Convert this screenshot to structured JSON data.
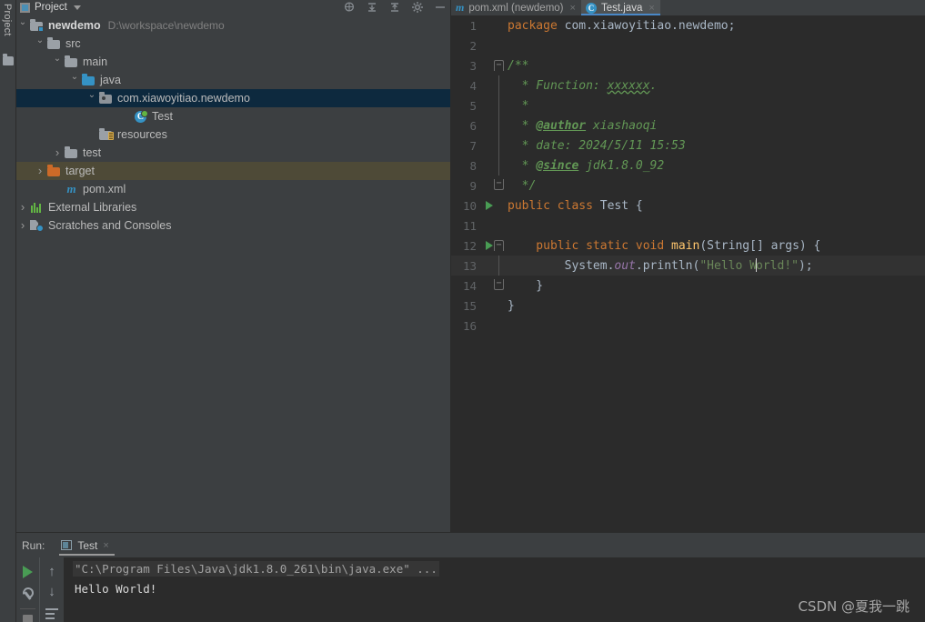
{
  "window": {
    "left_strip_label": "Project"
  },
  "project_panel": {
    "title": "Project",
    "icons": {
      "tab_icon": "project-panel-icon",
      "chevron": "chevron-down-icon",
      "tool_locate": "locate-file-icon",
      "tool_expand": "expand-all-icon",
      "tool_collapse": "collapse-all-icon",
      "tool_settings": "gear-icon",
      "tool_hide": "hide-panel-icon"
    },
    "tree": [
      {
        "label": "newdemo",
        "sub": "D:\\workspace\\newdemo",
        "icon": "module-folder-icon",
        "arrow": "down",
        "indent": 0,
        "state": "normal",
        "bold": true
      },
      {
        "label": "src",
        "sub": "",
        "icon": "folder-grey-icon",
        "arrow": "down",
        "indent": 1,
        "state": "normal",
        "bold": false
      },
      {
        "label": "main",
        "sub": "",
        "icon": "folder-grey-icon",
        "arrow": "down",
        "indent": 2,
        "state": "normal",
        "bold": false
      },
      {
        "label": "java",
        "sub": "",
        "icon": "folder-source-icon",
        "arrow": "down",
        "indent": 3,
        "state": "normal",
        "bold": false
      },
      {
        "label": "com.xiawoyitiao.newdemo",
        "sub": "",
        "icon": "package-icon",
        "arrow": "down",
        "indent": 4,
        "state": "selected",
        "bold": false
      },
      {
        "label": "Test",
        "sub": "",
        "icon": "java-class-icon",
        "arrow": "none",
        "indent": 5,
        "state": "normal",
        "bold": false
      },
      {
        "label": "resources",
        "sub": "",
        "icon": "folder-resources-icon",
        "arrow": "none",
        "indent": 3,
        "state": "normal",
        "bold": false
      },
      {
        "label": "test",
        "sub": "",
        "icon": "folder-grey-icon",
        "arrow": "right",
        "indent": 2,
        "state": "normal",
        "bold": false
      },
      {
        "label": "target",
        "sub": "",
        "icon": "folder-excluded-icon",
        "arrow": "right",
        "indent": 1,
        "state": "highlighted",
        "bold": false
      },
      {
        "label": "pom.xml",
        "sub": "",
        "icon": "maven-icon",
        "arrow": "none",
        "indent": 2,
        "state": "normal",
        "bold": false
      },
      {
        "label": "External Libraries",
        "sub": "",
        "icon": "libraries-icon",
        "arrow": "right",
        "indent": 0,
        "state": "normal",
        "bold": false
      },
      {
        "label": "Scratches and Consoles",
        "sub": "",
        "icon": "scratches-icon",
        "arrow": "right",
        "indent": 0,
        "state": "normal",
        "bold": false
      }
    ]
  },
  "editor": {
    "tabs": [
      {
        "label": "pom.xml (newdemo)",
        "icon": "maven-icon",
        "active": false,
        "close": "×"
      },
      {
        "label": "Test.java",
        "icon": "java-class-icon",
        "active": true,
        "close": "×"
      }
    ],
    "lines": [
      {
        "n": "1",
        "run": false,
        "fold": "",
        "foldline": false
      },
      {
        "n": "2",
        "run": false,
        "fold": "",
        "foldline": false
      },
      {
        "n": "3",
        "run": false,
        "fold": "top",
        "foldline": false
      },
      {
        "n": "4",
        "run": false,
        "fold": "",
        "foldline": true
      },
      {
        "n": "5",
        "run": false,
        "fold": "",
        "foldline": true
      },
      {
        "n": "6",
        "run": false,
        "fold": "",
        "foldline": true
      },
      {
        "n": "7",
        "run": false,
        "fold": "",
        "foldline": true
      },
      {
        "n": "8",
        "run": false,
        "fold": "",
        "foldline": true
      },
      {
        "n": "9",
        "run": false,
        "fold": "bot",
        "foldline": false
      },
      {
        "n": "10",
        "run": true,
        "fold": "",
        "foldline": false
      },
      {
        "n": "11",
        "run": false,
        "fold": "",
        "foldline": false
      },
      {
        "n": "12",
        "run": true,
        "fold": "top",
        "foldline": false
      },
      {
        "n": "13",
        "run": false,
        "fold": "",
        "foldline": true
      },
      {
        "n": "14",
        "run": false,
        "fold": "bot",
        "foldline": false
      },
      {
        "n": "15",
        "run": false,
        "fold": "",
        "foldline": false
      },
      {
        "n": "16",
        "run": false,
        "fold": "",
        "foldline": false
      }
    ],
    "code": {
      "l1_kw": "package",
      "l1_rest": " com.xiawoyitiao.newdemo;",
      "l3": "/**",
      "l4_pre": "  * Function: ",
      "l4_typo": "xxxxxx",
      "l4_post": ".",
      "l5": "  *",
      "l6_pre": "  * ",
      "l6_tag": "@author",
      "l6_post": " xiashaoqi",
      "l7": "  * date: 2024/5/11 15:53",
      "l8_pre": "  * ",
      "l8_tag": "@since",
      "l8_post": " jdk1.8.0_92",
      "l9": "  */",
      "l10_kw": "public class ",
      "l10_rest": "Test {",
      "l12_kw1": "    public static void ",
      "l12_fn": "main",
      "l12_rest": "(String[] args) {",
      "l13_pre": "        System.",
      "l13_fld": "out",
      "l13_mid": ".println(",
      "l13_str1": "\"Hello W",
      "l13_str2": "orld!\"",
      "l13_end": ");",
      "l14": "    }",
      "l15": "}"
    }
  },
  "run_panel": {
    "label": "Run:",
    "tab": {
      "label": "Test",
      "icon": "run-config-icon",
      "close": "×"
    },
    "toolbar": {
      "rerun": "run-icon",
      "settings": "wrench-icon",
      "stop": "stop-icon",
      "scroll_up": "↑",
      "scroll_down": "↓",
      "soft_wrap": "soft-wrap-icon"
    },
    "console": {
      "command": "\"C:\\Program Files\\Java\\jdk1.8.0_261\\bin\\java.exe\" ...",
      "output": "Hello World!"
    }
  },
  "watermark": "CSDN @夏我一跳",
  "colors": {
    "panel_bg": "#3c3f41",
    "editor_bg": "#2b2b2b",
    "selection": "#0d293e",
    "highlight": "#4e4a37",
    "accent": "#4a88c7",
    "keyword": "#cc7832",
    "string": "#6a8759",
    "comment": "#629755",
    "method": "#ffc66d",
    "field": "#9876aa",
    "run_green": "#499c54"
  }
}
